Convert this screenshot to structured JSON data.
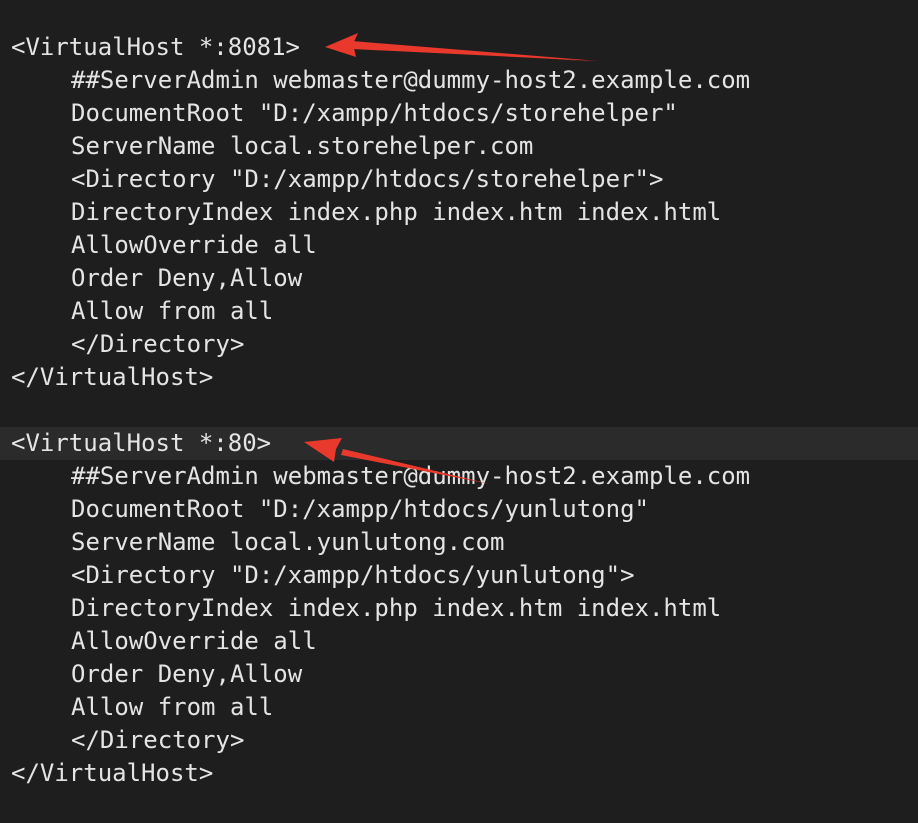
{
  "editor": {
    "blocks": [
      {
        "lines": [
          "<VirtualHost *:8081>",
          "##ServerAdmin webmaster@dummy-host2.example.com",
          "DocumentRoot \"D:/xampp/htdocs/storehelper\"",
          "ServerName local.storehelper.com",
          "<Directory \"D:/xampp/htdocs/storehelper\">",
          "DirectoryIndex index.php index.htm index.html",
          "AllowOverride all",
          "Order Deny,Allow",
          "Allow from all",
          "</Directory>",
          "</VirtualHost>"
        ]
      },
      {
        "lines": [
          "<VirtualHost *:80>",
          "##ServerAdmin webmaster@dummy-host2.example.com",
          "DocumentRoot \"D:/xampp/htdocs/yunlutong\"",
          "ServerName local.yunlutong.com",
          "<Directory \"D:/xampp/htdocs/yunlutong\">",
          "DirectoryIndex index.php index.htm index.html",
          "AllowOverride all",
          "Order Deny,Allow",
          "Allow from all",
          "</Directory>",
          "</VirtualHost>"
        ]
      }
    ]
  },
  "colors": {
    "background": "#1e1e1e",
    "text": "#e4e4e4",
    "current_line": "#2b2b2b",
    "annotation_arrow": "#e8392c"
  }
}
